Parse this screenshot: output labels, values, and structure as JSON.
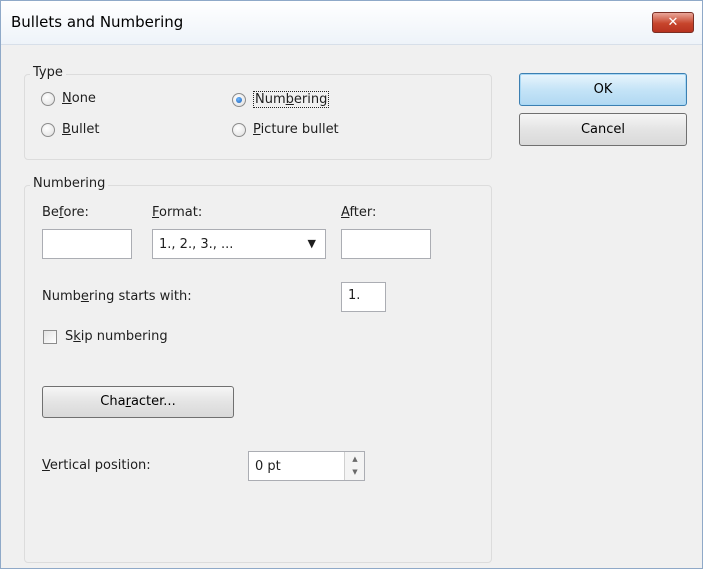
{
  "window": {
    "title": "Bullets and Numbering",
    "close_glyph": "✕"
  },
  "type_group": {
    "title": "Type",
    "options": [
      {
        "pre": "",
        "mnemonic": "N",
        "post": "one",
        "checked": false
      },
      {
        "pre": "Num",
        "mnemonic": "b",
        "post": "ering",
        "checked": true
      },
      {
        "pre": "",
        "mnemonic": "B",
        "post": "ullet",
        "checked": false
      },
      {
        "pre": "",
        "mnemonic": "P",
        "post": "icture bullet",
        "checked": false
      }
    ]
  },
  "numbering_group": {
    "title": "Numbering",
    "before": {
      "pre": "Be",
      "mnemonic": "f",
      "post": "ore:",
      "value": ""
    },
    "format": {
      "pre": "",
      "mnemonic": "F",
      "post": "ormat:",
      "value": "1., 2., 3., ..."
    },
    "after": {
      "pre": "",
      "mnemonic": "A",
      "post": "fter:",
      "value": ""
    },
    "starts_with": {
      "pre": "Numb",
      "mnemonic": "e",
      "post": "ring starts with:",
      "value": "1."
    },
    "skip": {
      "pre": "S",
      "mnemonic": "k",
      "post": "ip numbering",
      "checked": false
    },
    "character_button": {
      "pre": "Cha",
      "mnemonic": "r",
      "post": "acter..."
    },
    "vertical_position": {
      "pre": "",
      "mnemonic": "V",
      "post": "ertical position:",
      "value": "0 pt"
    }
  },
  "buttons": {
    "ok": "OK",
    "cancel": "Cancel"
  },
  "icons": {
    "spin_up": "▲",
    "spin_down": "▼",
    "dropdown": "▼"
  },
  "colors": {
    "accent": "#3c7fb1",
    "close": "#c7452c"
  }
}
